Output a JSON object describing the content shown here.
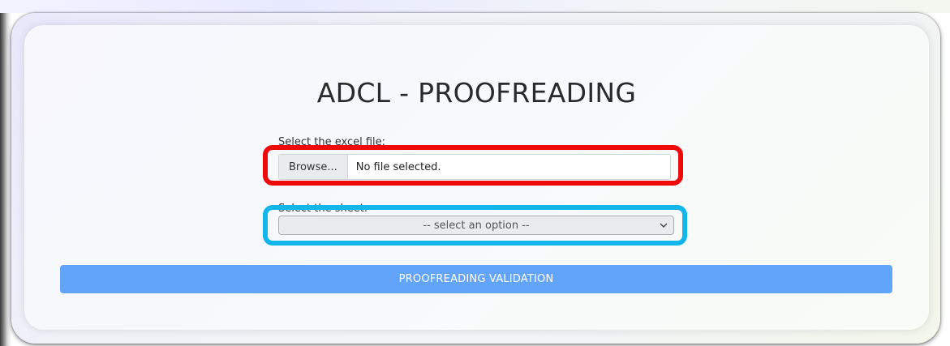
{
  "page": {
    "title": "ADCL - PROOFREADING"
  },
  "form": {
    "file_label": "Select the excel file:",
    "browse_label": "Browse...",
    "file_status": "No file selected.",
    "sheet_label": "Select the sheet:",
    "sheet_selected": "-- select an option --",
    "submit_label": "PROOFREADING VALIDATION"
  },
  "icons": {
    "select_chevron": "chevron-down-icon"
  },
  "colors": {
    "highlight_file": "#ee0a0a",
    "highlight_sheet": "#12b6ea",
    "submit_button": "#63a4fb"
  }
}
